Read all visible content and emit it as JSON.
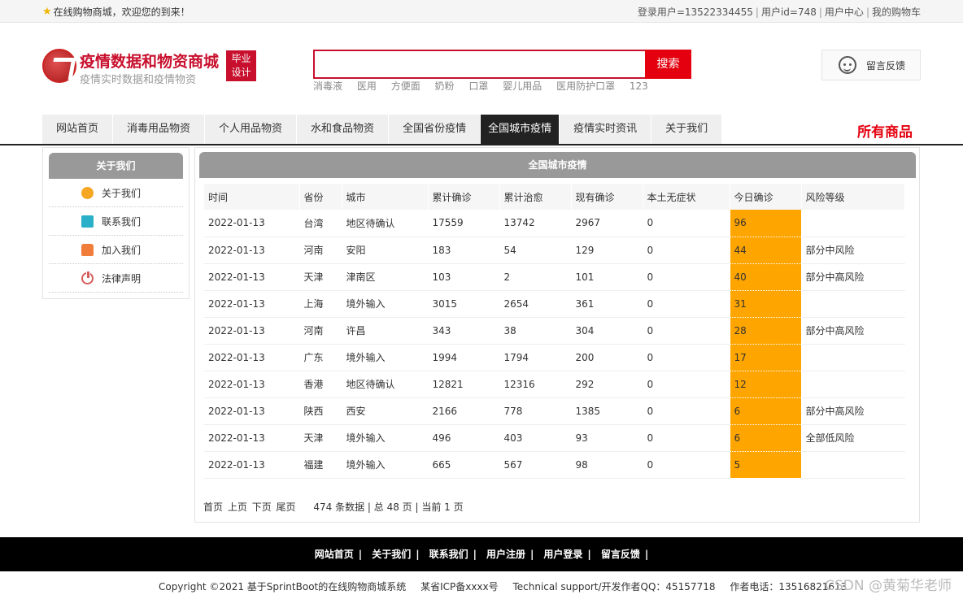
{
  "topbar": {
    "welcome": "在线购物商城，欢迎您的到来！",
    "user_label": "登录用户=13522334455",
    "userid_label": "用户id=748",
    "user_center": "用户中心",
    "cart": "我的购物车"
  },
  "logo": {
    "title": "疫情数据和物资商城",
    "subtitle": "疫情实时数据和疫情物资",
    "badge_line1": "毕业",
    "badge_line2": "设计"
  },
  "search": {
    "value": "",
    "button": "搜索",
    "hotwords": [
      "消毒液",
      "医用",
      "方便面",
      "奶粉",
      "口罩",
      "婴儿用品",
      "医用防护口罩",
      "123"
    ]
  },
  "feedback": {
    "label": "留言反馈"
  },
  "nav": {
    "items": [
      "网站首页",
      "消毒用品物资",
      "个人用品物资",
      "水和食品物资",
      "全国省份疫情",
      "全国城市疫情",
      "疫情实时资讯",
      "关于我们"
    ],
    "active_index": 5,
    "all_goods": "所有商品"
  },
  "sidebar": {
    "title": "关于我们",
    "items": [
      "关于我们",
      "联系我们",
      "加入我们",
      "法律声明"
    ]
  },
  "main": {
    "title": "全国城市疫情",
    "columns": [
      "时间",
      "省份",
      "城市",
      "累计确诊",
      "累计治愈",
      "现有确诊",
      "本土无症状",
      "今日确诊",
      "风险等级"
    ],
    "rows": [
      [
        "2022-01-13",
        "台湾",
        "地区待确认",
        "17559",
        "13742",
        "2967",
        "0",
        "96",
        ""
      ],
      [
        "2022-01-13",
        "河南",
        "安阳",
        "183",
        "54",
        "129",
        "0",
        "44",
        "部分中风险"
      ],
      [
        "2022-01-13",
        "天津",
        "津南区",
        "103",
        "2",
        "101",
        "0",
        "40",
        "部分中高风险"
      ],
      [
        "2022-01-13",
        "上海",
        "境外输入",
        "3015",
        "2654",
        "361",
        "0",
        "31",
        ""
      ],
      [
        "2022-01-13",
        "河南",
        "许昌",
        "343",
        "38",
        "304",
        "0",
        "28",
        "部分中高风险"
      ],
      [
        "2022-01-13",
        "广东",
        "境外输入",
        "1994",
        "1794",
        "200",
        "0",
        "17",
        ""
      ],
      [
        "2022-01-13",
        "香港",
        "地区待确认",
        "12821",
        "12316",
        "292",
        "0",
        "12",
        ""
      ],
      [
        "2022-01-13",
        "陕西",
        "西安",
        "2166",
        "778",
        "1385",
        "0",
        "6",
        "部分中高风险"
      ],
      [
        "2022-01-13",
        "天津",
        "境外输入",
        "496",
        "403",
        "93",
        "0",
        "6",
        "全部低风险"
      ],
      [
        "2022-01-13",
        "福建",
        "境外输入",
        "665",
        "567",
        "98",
        "0",
        "5",
        ""
      ]
    ],
    "pager": {
      "first": "首页",
      "prev": "上页",
      "next": "下页",
      "last": "尾页",
      "info": "474 条数据 | 总 48 页 | 当前 1 页"
    }
  },
  "footer": {
    "links": [
      "网站首页",
      "关于我们",
      "联系我们",
      "用户注册",
      "用户登录",
      "留言反馈"
    ],
    "copyright": "Copyright ©2021 基于SprintBoot的在线购物商城系统",
    "icp": "某省ICP备xxxx号",
    "support": "Technical support/开发作者QQ：45157718",
    "phone": "作者电话：13516821613",
    "watermark": "CSDN @黄菊华老师"
  },
  "colors": {
    "brand_red": "#c8102e",
    "search_button": "#e4000f",
    "today_highlight": "#ffa500",
    "nav_active": "#222222",
    "panel_header": "#999999"
  }
}
